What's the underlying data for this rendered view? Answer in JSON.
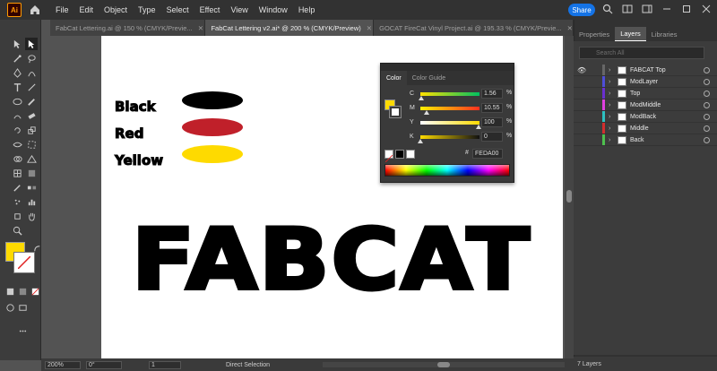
{
  "app": {
    "logo": "Ai",
    "menu": [
      "File",
      "Edit",
      "Object",
      "Type",
      "Select",
      "Effect",
      "View",
      "Window",
      "Help"
    ],
    "share_label": "Share"
  },
  "tabs": [
    {
      "label": "FabCat Lettering.ai @ 150 % (CMYK/Previe...",
      "active": false
    },
    {
      "label": "FabCat Lettering v2.ai* @ 200 % (CMYK/Preview)",
      "active": true
    },
    {
      "label": "GOCAT FireCat Vinyl Project.ai @ 195.33 % (CMYK/Previe...",
      "active": false
    }
  ],
  "artboard": {
    "labels": [
      "Black",
      "Red",
      "Yellow"
    ],
    "swatch_colors": [
      "#000000",
      "#c0202a",
      "#feda00"
    ],
    "title": "FABCAT"
  },
  "color_panel": {
    "tabs": [
      "Color",
      "Color Guide"
    ],
    "channels": [
      {
        "label": "C",
        "value": "1.56",
        "unit": "%",
        "fraction": 0.0156
      },
      {
        "label": "M",
        "value": "10.55",
        "unit": "%",
        "fraction": 0.1055
      },
      {
        "label": "Y",
        "value": "100",
        "unit": "%",
        "fraction": 1.0
      },
      {
        "label": "K",
        "value": "0",
        "unit": "%",
        "fraction": 0.0
      }
    ],
    "hex_prefix": "#",
    "hex": "FEDA00",
    "fill_color": "#feda00"
  },
  "right_panel": {
    "tabs": [
      "Properties",
      "Layers",
      "Libraries"
    ],
    "search_placeholder": "Search All",
    "layers": [
      {
        "name": "FABCAT Top",
        "color": "#666666"
      },
      {
        "name": "ModLayer",
        "color": "#4e4ed8"
      },
      {
        "name": "Top",
        "color": "#6a2fd0"
      },
      {
        "name": "ModMiddle",
        "color": "#e040e0"
      },
      {
        "name": "ModBack",
        "color": "#2ec0c0"
      },
      {
        "name": "Middle",
        "color": "#d02f2f"
      },
      {
        "name": "Back",
        "color": "#4ec04e"
      }
    ],
    "footer": "7 Layers"
  },
  "status": {
    "zoom": "200%",
    "rotation": "0°",
    "page": "1",
    "tool": "Direct Selection"
  },
  "fill_color": "#feda00"
}
